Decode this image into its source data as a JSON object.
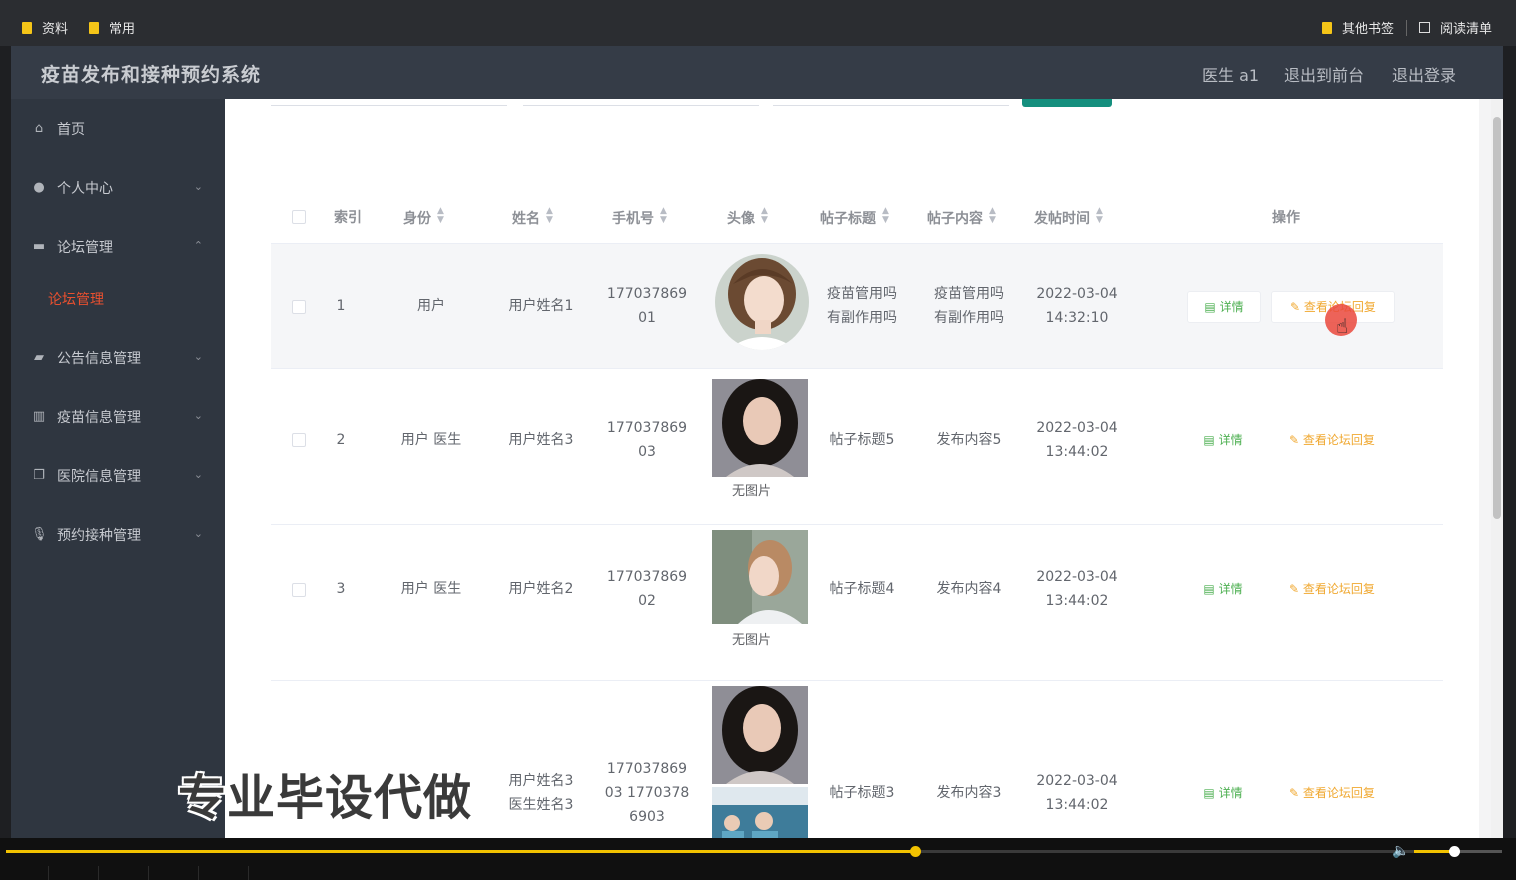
{
  "bookmarks": {
    "left": [
      "资料",
      "常用"
    ],
    "other": "其他书签",
    "reading_list": "阅读清单"
  },
  "header": {
    "title": "疫苗发布和接种预约系统",
    "user": "医生 a1",
    "to_front": "退出到前台",
    "logout": "退出登录"
  },
  "sidebar": {
    "items": [
      {
        "label": "首页",
        "icon": "home-icon"
      },
      {
        "label": "个人中心",
        "icon": "user-icon"
      },
      {
        "label": "论坛管理",
        "icon": "monitor-icon"
      },
      {
        "label": "公告信息管理",
        "icon": "ticket-icon"
      },
      {
        "label": "疫苗信息管理",
        "icon": "library-icon"
      },
      {
        "label": "医院信息管理",
        "icon": "copy-icon"
      },
      {
        "label": "预约接种管理",
        "icon": "microphone-icon"
      }
    ],
    "active_sub": "论坛管理"
  },
  "table": {
    "columns": [
      "索引",
      "身份",
      "姓名",
      "手机号",
      "头像",
      "帖子标题",
      "帖子内容",
      "发帖时间",
      "操作"
    ],
    "detail_label": "详情",
    "reply_label": "查看论坛回复",
    "no_image": "无图片",
    "rows": [
      {
        "index": "1",
        "role": "用户",
        "name": "用户姓名1",
        "phone": "177037869\n01",
        "title": "疫苗管用吗\n有副作用吗",
        "content": "疫苗管用吗\n有副作用吗",
        "time": "2022-03-04\n14:32:10"
      },
      {
        "index": "2",
        "role": "用户 医生",
        "name": "用户姓名3",
        "phone": "177037869\n03",
        "title": "帖子标题5",
        "content": "发布内容5",
        "time": "2022-03-04\n13:44:02"
      },
      {
        "index": "3",
        "role": "用户 医生",
        "name": "用户姓名2",
        "phone": "177037869\n02",
        "title": "帖子标题4",
        "content": "发布内容4",
        "time": "2022-03-04\n13:44:02"
      },
      {
        "index": "4",
        "role": "",
        "name": "用户姓名3\n医生姓名3",
        "phone": "177037869\n03 1770378\n6903",
        "title": "帖子标题3",
        "content": "发布内容3",
        "time": "2022-03-04\n13:44:02"
      }
    ]
  },
  "watermark": "专业毕设代做",
  "player": {
    "progress": 0.61,
    "volume": 0.45
  },
  "colors": {
    "accent": "#158f7e",
    "active_nav": "#e8502f",
    "progress": "#f2c200",
    "reply": "#f0a830",
    "detail": "#4caf50"
  }
}
